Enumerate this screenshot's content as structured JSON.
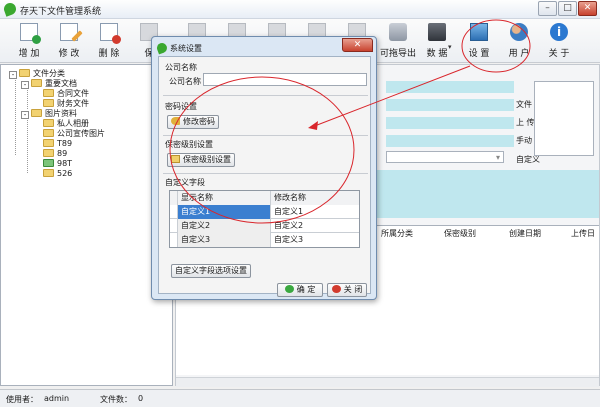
{
  "window": {
    "title": "存天下文件管理系统",
    "buttons": [
      "–",
      "□",
      "✕"
    ]
  },
  "toolbar": {
    "items": [
      {
        "label": "增 加",
        "icon": "add-document-icon"
      },
      {
        "label": "修 改",
        "icon": "edit-document-icon"
      },
      {
        "label": "删 除",
        "icon": "delete-document-icon"
      },
      {
        "label": "保",
        "icon": "save-icon"
      },
      {
        "label": "可拖导出",
        "icon": "export-icon"
      },
      {
        "label": "数 据",
        "icon": "data-icon"
      },
      {
        "label": "设 置",
        "icon": "settings-icon"
      },
      {
        "label": "用 户",
        "icon": "user-icon"
      },
      {
        "label": "关 于",
        "icon": "about-icon"
      }
    ]
  },
  "tree": {
    "root": "文件分类",
    "nodes": [
      {
        "label": "重要文档",
        "children": [
          "合同文件",
          "财务文件"
        ]
      },
      {
        "label": "图片资料",
        "children": [
          "私人相册",
          "公司宣传图片",
          "T89",
          "89",
          "98T",
          "526"
        ]
      }
    ]
  },
  "main": {
    "labels": [
      "文件",
      "上 传",
      "手动",
      "自定义"
    ],
    "columns": [
      "所属分类",
      "保密级别",
      "创建日期",
      "上传日"
    ]
  },
  "status": {
    "user_label": "使用者：",
    "user": "admin",
    "count_label": "文件数：",
    "count": "0"
  },
  "dialog": {
    "title": "系统设置",
    "company": {
      "section": "公司名称",
      "label": "公司名称",
      "value": ""
    },
    "password": {
      "section": "密码设置",
      "button": "修改密码"
    },
    "security": {
      "section": "保密级别设置",
      "button": "保密级别设置"
    },
    "custom": {
      "section": "自定义字段",
      "headers": [
        "显示名称",
        "修改名称"
      ],
      "rows": [
        [
          "自定义1",
          "自定义1"
        ],
        [
          "自定义2",
          "自定义2"
        ],
        [
          "自定义3",
          "自定义3"
        ]
      ],
      "options_button": "自定义字段选项设置"
    },
    "ok_button": "确 定",
    "close_button": "关 闭"
  },
  "colors": {
    "annotation": "#d9262c",
    "accent": "#3b7fd0",
    "panel_cyan": "#bfe7ee"
  }
}
